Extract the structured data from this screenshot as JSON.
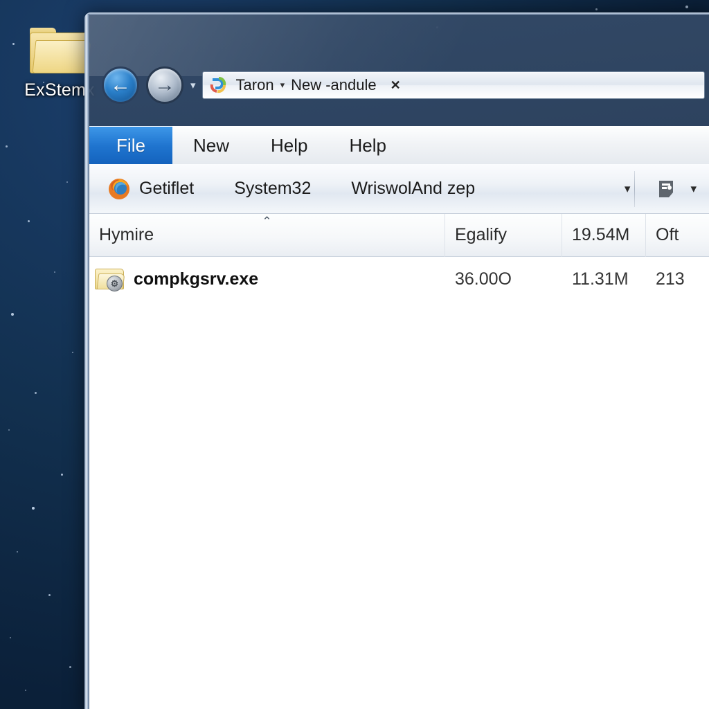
{
  "desktop": {
    "icon": {
      "label": "ExStemx",
      "icon": "folder-icon"
    }
  },
  "window": {
    "nav": {
      "back_icon": "back-arrow-icon",
      "back_glyph": "←",
      "forward_icon": "forward-arrow-icon",
      "forward_glyph": "→",
      "history_caret": "▾"
    },
    "address": {
      "icon": "explorer-icon",
      "crumb1": "Taron",
      "separator": "▾",
      "crumb2": "New -andule",
      "close": "✕"
    },
    "menu": {
      "items": [
        {
          "label": "File",
          "active": true
        },
        {
          "label": "New",
          "active": false
        },
        {
          "label": "Help",
          "active": false
        },
        {
          "label": "Help",
          "active": false
        }
      ]
    },
    "toolbar": {
      "app_icon": "firefox-icon",
      "item1": "Getiflet",
      "item2": "System32",
      "item3": "WriswolAnd zep",
      "item3_caret": "▾",
      "view_icon": "view-layout-icon",
      "view_caret": "▾"
    },
    "columns": [
      {
        "label": "Hymire",
        "sort_caret": "⌃"
      },
      {
        "label": "Egalify",
        "sort_caret": ""
      },
      {
        "label": "19.54M",
        "sort_caret": ""
      },
      {
        "label": "Oft",
        "sort_caret": ""
      }
    ],
    "rows": [
      {
        "icon": "folder-gear-icon",
        "name": "compkgsrv.exe",
        "c1": "36.00O",
        "c2": "11.31M",
        "c3": "213"
      }
    ]
  },
  "colors": {
    "accent_blue": "#1f74cf",
    "desktop_navy": "#12304f",
    "glass_frame": "#3a5475",
    "list_bg": "#ffffff"
  }
}
